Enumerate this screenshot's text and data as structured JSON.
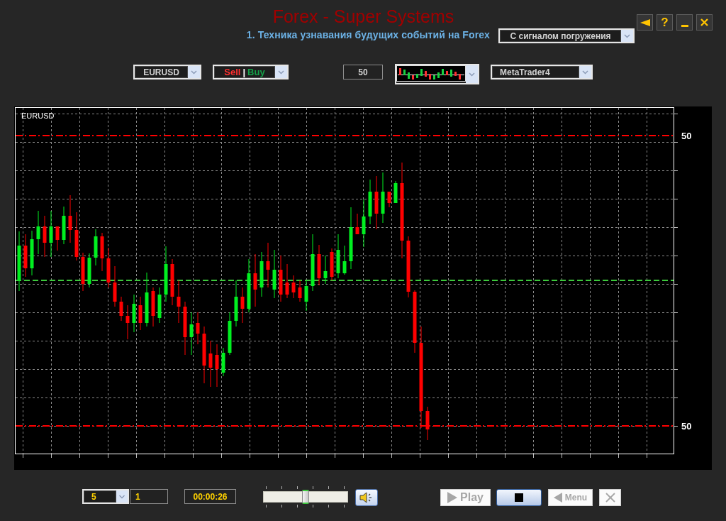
{
  "header": {
    "title": "Forex - Super Systems",
    "subtitle": "1. Техника узнавания будущих событий на Forex",
    "mode_dropdown": {
      "value": "С сигналом погружения"
    }
  },
  "window_buttons": [
    {
      "kind": "back"
    },
    {
      "kind": "help",
      "label": "?"
    },
    {
      "kind": "minimize"
    },
    {
      "kind": "close"
    }
  ],
  "toolbar": {
    "symbol_dropdown": {
      "value": "EURUSD"
    },
    "direction_dropdown": {
      "sell": "Sell",
      "separator": "|",
      "buy": "Buy"
    },
    "period_field": {
      "value": "50"
    },
    "platform_dropdown": {
      "value": "MetaTrader4"
    }
  },
  "chart": {
    "symbol": "EURUSD",
    "level_labels": [
      "50",
      "50"
    ]
  },
  "playback": {
    "speed_dropdown": {
      "value": "5"
    },
    "step_field": {
      "value": "1"
    },
    "timer": "00:00:26",
    "speed_slider": {
      "level": 0.5
    },
    "sound_button": {
      "muted": false
    },
    "buttons": [
      {
        "kind": "play",
        "label": "Play",
        "disabled": true
      },
      {
        "kind": "stop",
        "disabled": false
      },
      {
        "kind": "menu",
        "label": "Menu",
        "disabled": true
      },
      {
        "kind": "close",
        "disabled": true
      }
    ]
  }
}
